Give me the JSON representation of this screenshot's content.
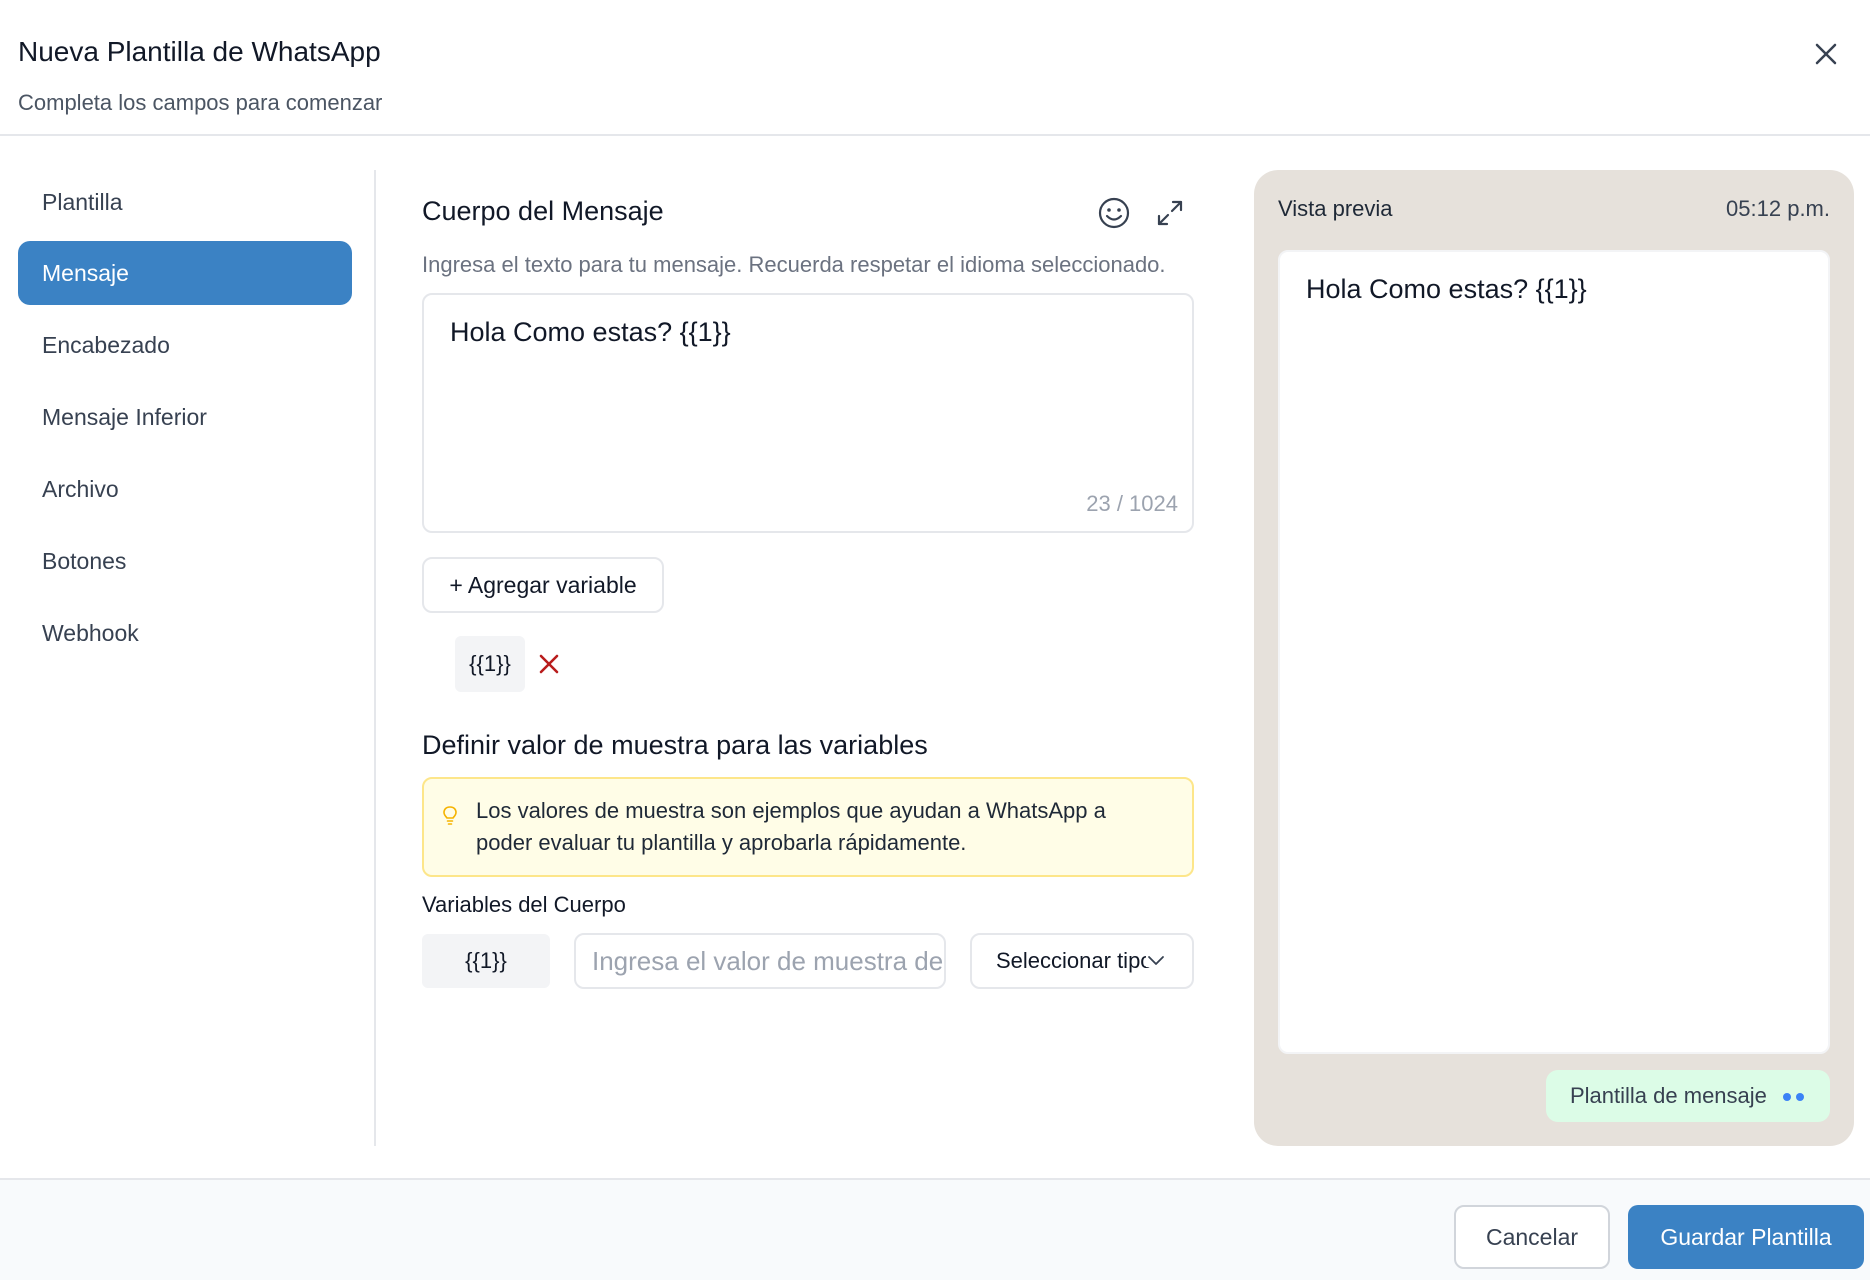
{
  "header": {
    "title": "Nueva Plantilla de WhatsApp",
    "subtitle": "Completa los campos para comenzar"
  },
  "sidebar": {
    "items": [
      {
        "label": "Plantilla",
        "active": false
      },
      {
        "label": "Mensaje",
        "active": true
      },
      {
        "label": "Encabezado",
        "active": false
      },
      {
        "label": "Mensaje Inferior",
        "active": false
      },
      {
        "label": "Archivo",
        "active": false
      },
      {
        "label": "Botones",
        "active": false
      },
      {
        "label": "Webhook",
        "active": false
      }
    ]
  },
  "message": {
    "section_title": "Cuerpo del Mensaje",
    "help_text": "Ingresa el texto para tu mensaje. Recuerda respetar el idioma seleccionado.",
    "body_text": "Hola Como estas?  {{1}}",
    "char_counter": "23 / 1024",
    "add_variable_label": "+ Agregar variable",
    "variables": [
      "{{1}}"
    ]
  },
  "samples": {
    "section_title": "Definir valor de muestra para las variables",
    "info_text": "Los valores de muestra son ejemplos que ayudan a WhatsApp a poder evaluar tu plantilla y aprobarla rápidamente.",
    "body_vars_label": "Variables del Cuerpo",
    "rows": [
      {
        "variable": "{{1}}",
        "placeholder": "Ingresa el valor de muestra de la variable",
        "type_select": "Seleccionar tipo"
      }
    ]
  },
  "preview": {
    "title": "Vista previa",
    "time": "05:12 p.m.",
    "bubble_text": "Hola Como estas?  {{1}}",
    "tag": "Plantilla de mensaje"
  },
  "footer": {
    "cancel_label": "Cancelar",
    "save_label": "Guardar Plantilla"
  },
  "colors": {
    "accent": "#3b82c4",
    "preview_bg": "#e6e1db",
    "info_bg": "#fffde7",
    "danger": "#b91c1c",
    "tag_bg": "#dcfce7"
  },
  "icons": [
    "close-icon",
    "emoji-icon",
    "expand-icon",
    "remove-variable-icon",
    "lightbulb-icon",
    "chevron-down-icon",
    "dots-icon"
  ]
}
